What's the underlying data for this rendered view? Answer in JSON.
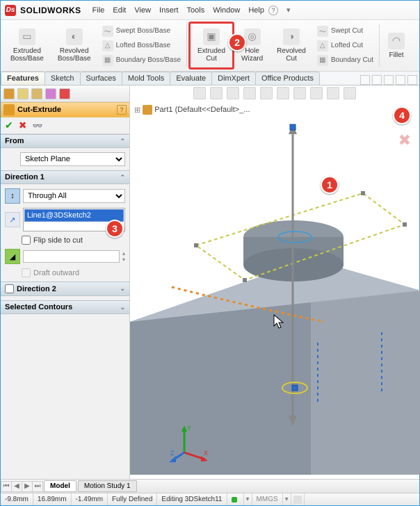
{
  "app": {
    "title": "SOLIDWORKS"
  },
  "menu": [
    "File",
    "Edit",
    "View",
    "Insert",
    "Tools",
    "Window",
    "Help"
  ],
  "ribbon": {
    "extruded_boss": "Extruded\nBoss/Base",
    "revolved_boss": "Revolved\nBoss/Base",
    "swept_boss": "Swept Boss/Base",
    "lofted_boss": "Lofted Boss/Base",
    "boundary_boss": "Boundary Boss/Base",
    "extruded_cut": "Extruded\nCut",
    "hole_wizard": "Hole\nWizard",
    "revolved_cut": "Revolved\nCut",
    "swept_cut": "Swept Cut",
    "lofted_cut": "Lofted Cut",
    "boundary_cut": "Boundary Cut",
    "fillet": "Fillet"
  },
  "cmdtabs": [
    "Features",
    "Sketch",
    "Surfaces",
    "Mold Tools",
    "Evaluate",
    "DimXpert",
    "Office Products"
  ],
  "pm": {
    "title": "Cut-Extrude",
    "from_label": "From",
    "from_value": "Sketch Plane",
    "dir1_label": "Direction 1",
    "end_condition": "Through All",
    "dir_vector": "Line1@3DSketch2",
    "flip_label": "Flip side to cut",
    "draft_label": "Draft outward",
    "dir2_label": "Direction 2",
    "selcon_label": "Selected Contours"
  },
  "crumb": "Part1  (Default<<Default>_...",
  "modeltabs": {
    "model": "Model",
    "motion": "Motion Study 1"
  },
  "status": {
    "c1": "-9.8mm",
    "c2": "16.89mm",
    "c3": "-1.49mm",
    "c4": "Fully Defined",
    "c5": "Editing 3DSketch11",
    "c6": "MMGS"
  },
  "callouts": {
    "c1": "1",
    "c2": "2",
    "c3": "3",
    "c4": "4"
  }
}
